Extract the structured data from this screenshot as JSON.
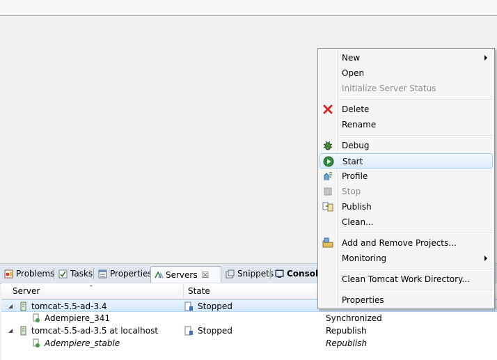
{
  "tabs": [
    {
      "label": "Problems",
      "icon": "problems-icon"
    },
    {
      "label": "Tasks",
      "icon": "tasks-icon"
    },
    {
      "label": "Properties",
      "icon": "properties-icon"
    },
    {
      "label": "Servers",
      "icon": "servers-icon",
      "close": "☒"
    },
    {
      "label": "Snippets",
      "icon": "snippets-icon"
    },
    {
      "label": "Console",
      "icon": "console-icon"
    }
  ],
  "table": {
    "columns": [
      "Server",
      "State"
    ],
    "rows": [
      {
        "name": "tomcat-5.5-ad-3.4",
        "state": "Stopped",
        "status": "",
        "expander": "◢"
      },
      {
        "name": "Adempiere_341",
        "state": "",
        "status": "Synchronized"
      },
      {
        "name": "tomcat-5.5-ad-3.5 at localhost",
        "state": "Stopped",
        "status": "Republish",
        "expander": "◢"
      },
      {
        "name": "Adempiere_stable",
        "state": "",
        "status": "Republish"
      }
    ]
  },
  "menu": {
    "items": {
      "new": "New",
      "open": "Open",
      "init": "Initialize Server Status",
      "delete": "Delete",
      "rename": "Rename",
      "debug": "Debug",
      "start": "Start",
      "profile": "Profile",
      "stop": "Stop",
      "publish": "Publish",
      "clean": "Clean...",
      "addremove": "Add and Remove Projects...",
      "monitoring": "Monitoring",
      "cleantomcat": "Clean Tomcat Work Directory...",
      "properties": "Properties"
    }
  },
  "colors": {
    "selection": "#d5e9fb",
    "menu_bg": "#f5f5f5",
    "tabbar": "#dfe6ee"
  }
}
